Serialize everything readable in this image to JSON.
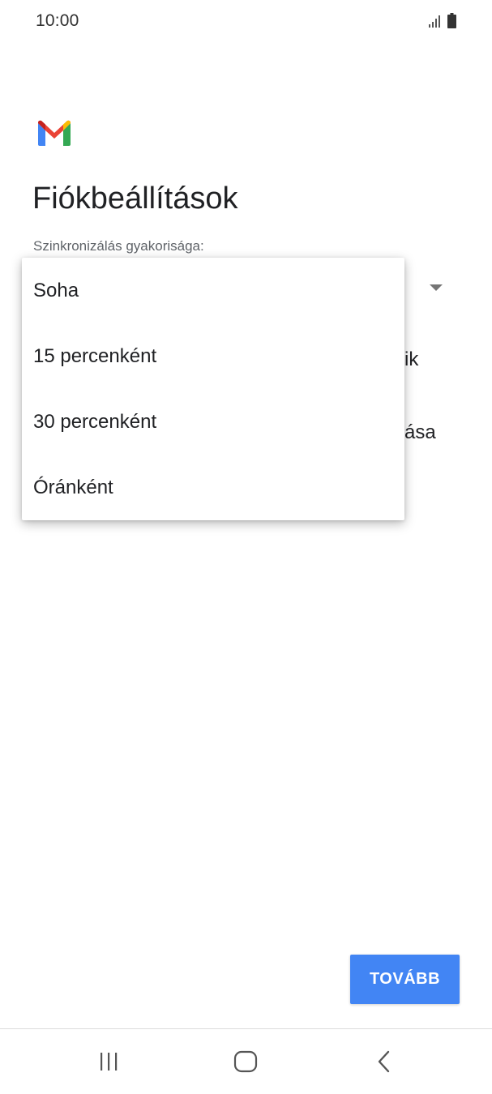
{
  "status_bar": {
    "time": "10:00",
    "icons": [
      "signal-icon",
      "battery-icon"
    ]
  },
  "app": {
    "logo": "gmail-logo",
    "title": "Fiókbeállítások"
  },
  "sync_frequency": {
    "label": "Szinkronizálás gyakorisága:"
  },
  "background_partial_texts": [
    "ik",
    "ása"
  ],
  "dropdown": {
    "options": [
      "Soha",
      "15 percenként",
      "30 percenként",
      "Óránként"
    ]
  },
  "next_button": {
    "label": "TOVÁBB"
  },
  "nav_bar": {
    "icons": [
      "recent-apps-icon",
      "home-icon",
      "back-icon"
    ]
  },
  "colors": {
    "accent": "#4285f4",
    "gmail_red": "#ea4335",
    "gmail_blue": "#4285f4",
    "gmail_green": "#34a853",
    "gmail_yellow": "#fbbc04"
  }
}
